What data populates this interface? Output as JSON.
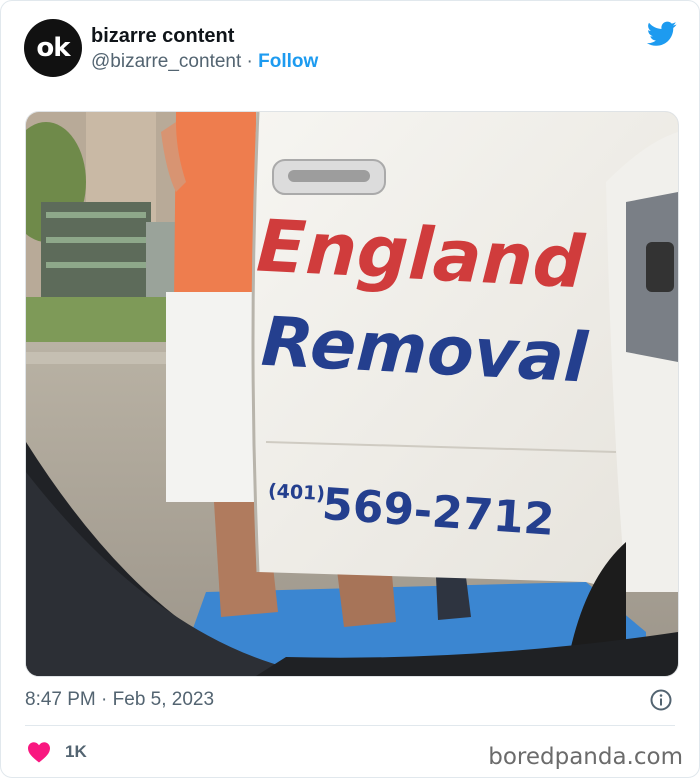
{
  "tweet": {
    "avatar_text": "ok",
    "display_name": "bizarre content",
    "handle": "@bizarre_content",
    "separator": " · ",
    "follow_label": "Follow",
    "time": "8:47 PM",
    "date": "Feb 5, 2023",
    "likes": "1K"
  },
  "photo": {
    "door_line1": "England",
    "door_line2": "Removal",
    "phone_area": "(401)",
    "phone_number": "569-2712"
  },
  "watermark": "boredpanda.com",
  "icons": {
    "brand": "twitter-bird-icon",
    "info": "info-icon",
    "like": "heart-icon"
  },
  "colors": {
    "accent": "#1d9bf0",
    "heart": "#f91880",
    "door_red": "#d03c3c",
    "door_blue": "#243f8e"
  }
}
